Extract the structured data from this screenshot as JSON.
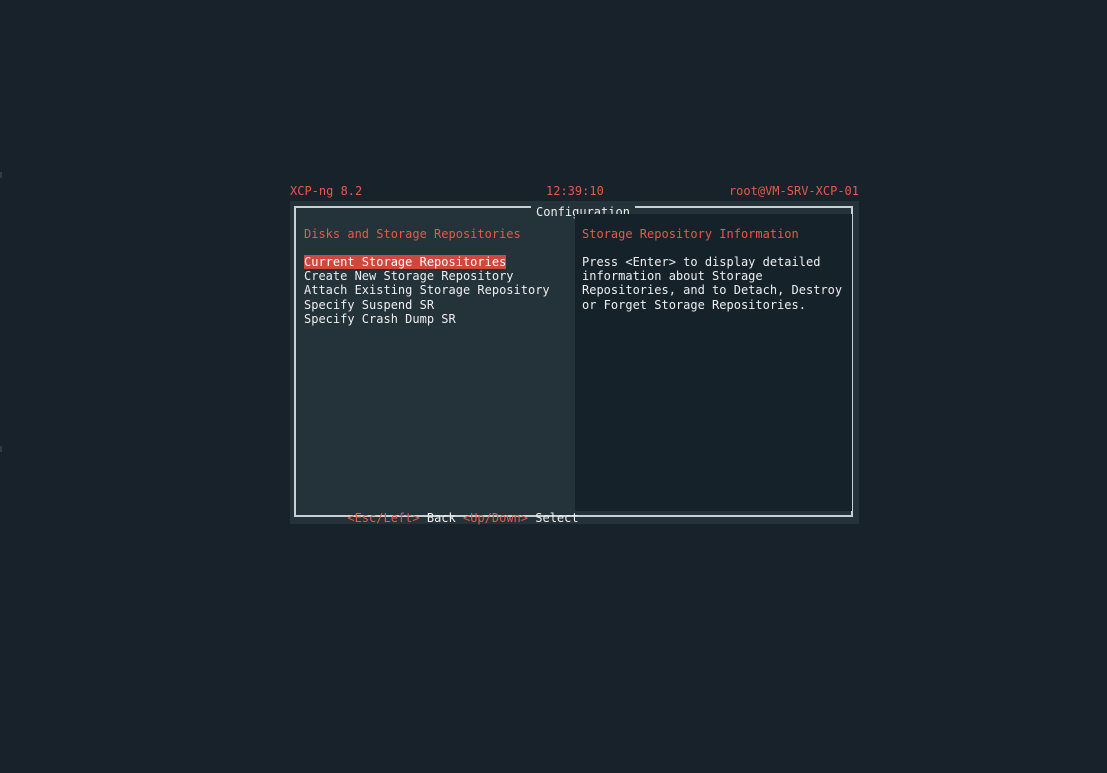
{
  "header": {
    "product": "XCP-ng 8.2",
    "clock": "12:39:10",
    "user_host": "root@VM-SRV-XCP-01"
  },
  "dialog": {
    "title": "Configuration",
    "left": {
      "heading": "Disks and Storage Repositories",
      "items": [
        {
          "label": "Current Storage Repositories",
          "selected": true
        },
        {
          "label": "Create New Storage Repository",
          "selected": false
        },
        {
          "label": "Attach Existing Storage Repository",
          "selected": false
        },
        {
          "label": "Specify Suspend SR",
          "selected": false
        },
        {
          "label": "Specify Crash Dump SR",
          "selected": false
        }
      ]
    },
    "right": {
      "heading": "Storage Repository Information",
      "body": "Press <Enter> to display detailed\ninformation about Storage\nRepositories, and to Detach, Destroy\nor Forget Storage Repositories."
    },
    "footer": {
      "back_key": "<Esc/Left>",
      "back_label": "Back",
      "select_key": "<Up/Down>",
      "select_label": "Select"
    }
  },
  "colors": {
    "background": "#18222a",
    "panel": "#243239",
    "info_panel": "#16222a",
    "accent": "#e8584d",
    "selection": "#d0473d",
    "text": "#eeeeee",
    "frame": "#c9d0d4"
  }
}
